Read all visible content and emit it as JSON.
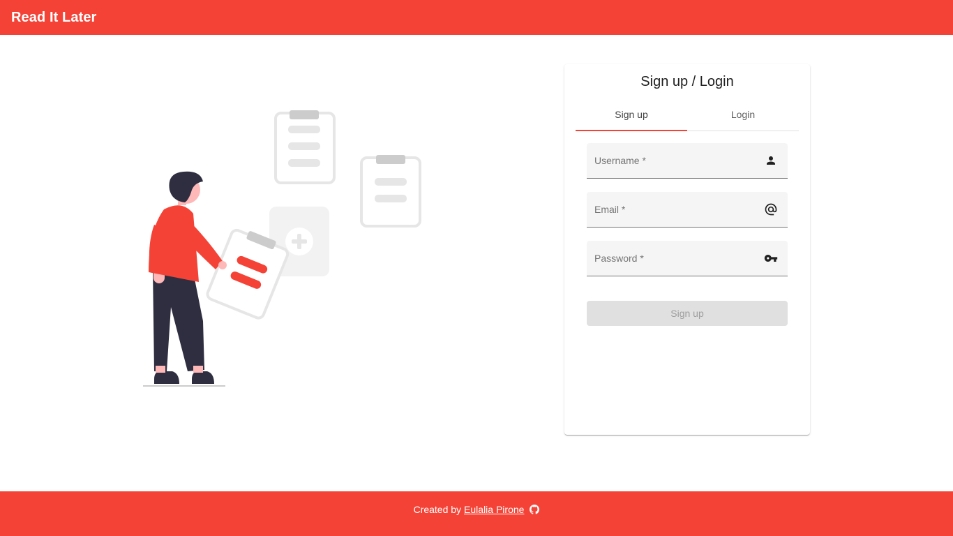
{
  "header": {
    "title": "Read It Later"
  },
  "auth_card": {
    "title": "Sign up / Login",
    "tabs": [
      {
        "label": "Sign up",
        "active": true
      },
      {
        "label": "Login",
        "active": false
      }
    ],
    "fields": {
      "username": {
        "label": "Username *",
        "value": "",
        "icon": "person-icon"
      },
      "email": {
        "label": "Email *",
        "value": "",
        "icon": "at-sign-icon"
      },
      "password": {
        "label": "Password *",
        "value": "",
        "icon": "key-icon"
      }
    },
    "submit_label": "Sign up",
    "submit_disabled": true
  },
  "footer": {
    "prefix": "Created by",
    "author_link": "Eulalia Pirone",
    "icon": "github-icon"
  },
  "colors": {
    "primary": "#f44336",
    "figure_dark": "#2f2e41",
    "skin": "#ffb8b8",
    "muted_gray": "#e6e6e6",
    "clip_gray": "#cccccc"
  }
}
